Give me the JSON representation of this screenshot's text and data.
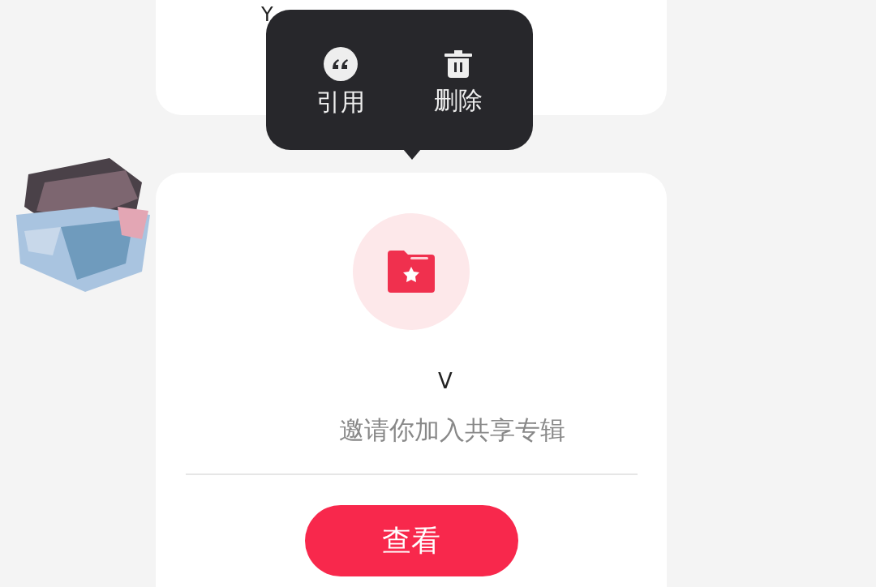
{
  "previous_message": {
    "text": "Y"
  },
  "context_menu": {
    "items": [
      {
        "kind": "quote",
        "label": "引用"
      },
      {
        "kind": "delete",
        "label": "删除"
      }
    ]
  },
  "share_card": {
    "name": "V",
    "message": "邀请你加入共享专辑",
    "button": "查看"
  }
}
